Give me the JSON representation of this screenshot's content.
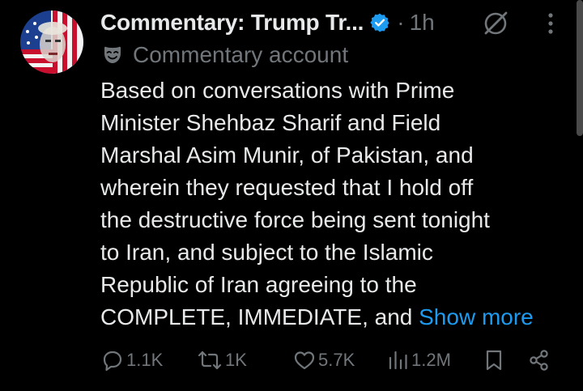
{
  "post": {
    "display_name": "Commentary: Trump Tr...",
    "separator": "·",
    "time": "1h",
    "account_label": "Commentary account",
    "body_lines": [
      "Based on conversations with Prime",
      "Minister Shehbaz Sharif and Field",
      "Marshal Asim Munir, of Pakistan, and",
      "wherein they requested that I hold off",
      "the destructive force being sent tonight",
      "to Iran, and subject to the Islamic",
      "Republic of Iran agreeing to the",
      "COMPLETE, IMMEDIATE, and "
    ],
    "show_more": "Show more"
  },
  "actions": {
    "replies": "1.1K",
    "reposts": "1K",
    "likes": "5.7K",
    "views": "1.2M"
  },
  "icons": {
    "verified": "verified-badge-icon",
    "grok": "grok-icon",
    "more": "more-vertical-icon",
    "label": "mask-icon",
    "reply": "reply-icon",
    "repost": "repost-icon",
    "like": "heart-icon",
    "views": "views-chart-icon",
    "bookmark": "bookmark-icon",
    "share": "share-icon"
  },
  "colors": {
    "background": "#000000",
    "text": "#e7e9ea",
    "muted": "#71767b",
    "accent": "#1d9bf0"
  }
}
